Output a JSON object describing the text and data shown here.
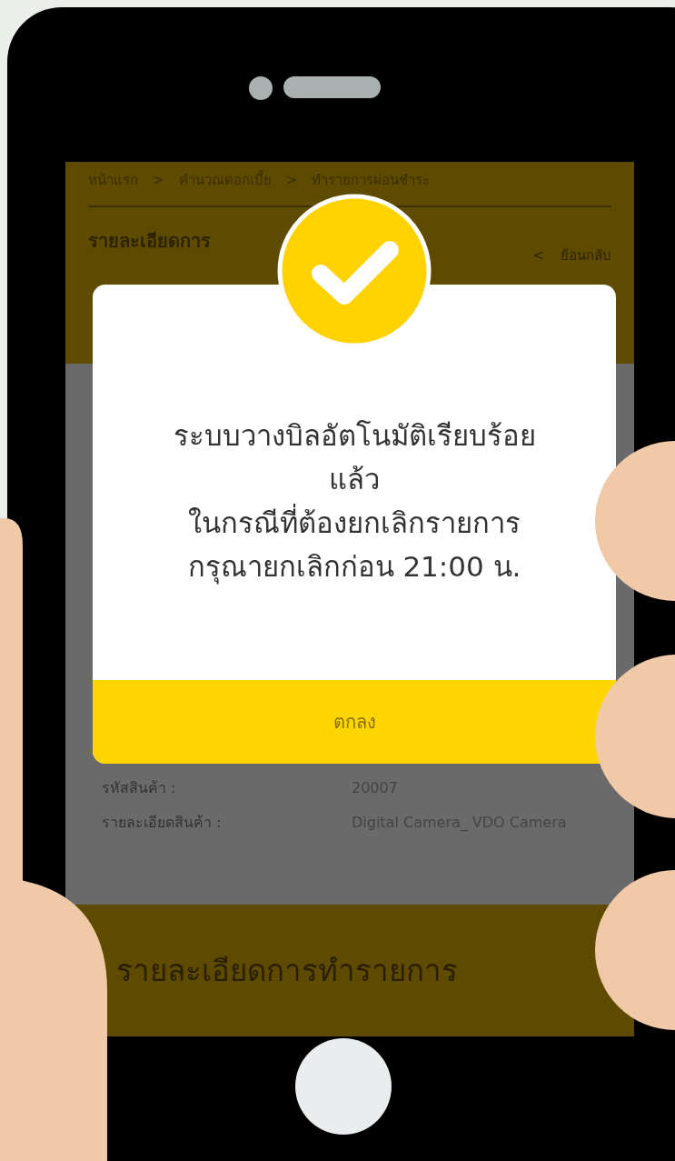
{
  "breadcrumb": [
    "หน้าแรก",
    "คำนวณดอกเบี้ย",
    "ทำรายการผ่อนชำระ"
  ],
  "breadcrumb_separator": ">",
  "page_title": "รายละเอียดการ",
  "back_link": {
    "icon": "<",
    "label": "ย้อนกลับ"
  },
  "details": [
    {
      "label": "รหัสสินค้า :",
      "value": "20007"
    },
    {
      "label": "รายละเอียดสินค้า :",
      "value": "Digital Camera_ VDO Camera"
    }
  ],
  "section_title": "รายละเอียดการทำรายการ",
  "dialog": {
    "message": [
      "ระบบวางบิลอัตโนมัติเรียบร้อย",
      "แล้ว",
      "ในกรณีที่ต้องยกเลิกรายการ",
      "กรุณายกเลิกก่อน 21:00 น."
    ],
    "button": "ตกลง"
  }
}
